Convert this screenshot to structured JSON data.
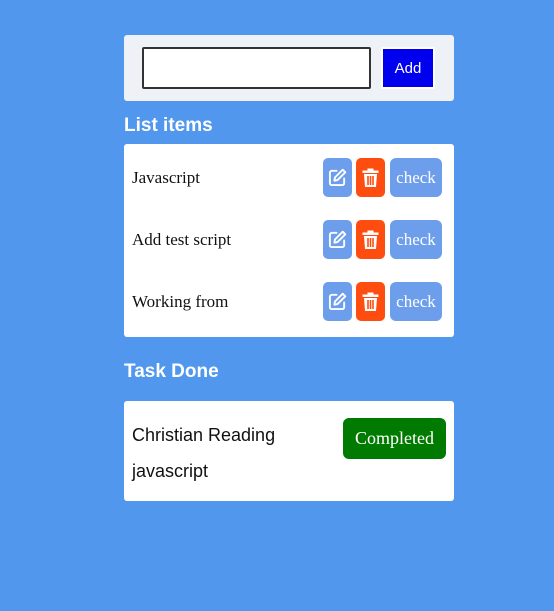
{
  "input": {
    "value": "",
    "placeholder": ""
  },
  "add_button_label": "Add",
  "list_section": {
    "title": "List items",
    "items": [
      {
        "label": "Javascript",
        "check_label": "check"
      },
      {
        "label": "Add test script",
        "check_label": "check"
      },
      {
        "label": "Working from",
        "check_label": "check"
      }
    ]
  },
  "done_section": {
    "title": "Task Done",
    "items": [
      {
        "label": "Christian Reading javascript",
        "status_label": "Completed"
      }
    ]
  },
  "colors": {
    "background": "#5297ee",
    "add_button": "#0000ee",
    "edit_button": "#6d9eeb",
    "delete_button": "#ff4c0f",
    "check_button": "#6d9eeb",
    "completed_button": "#007a00"
  },
  "icons": {
    "edit": "edit-icon",
    "delete": "trash-icon"
  }
}
